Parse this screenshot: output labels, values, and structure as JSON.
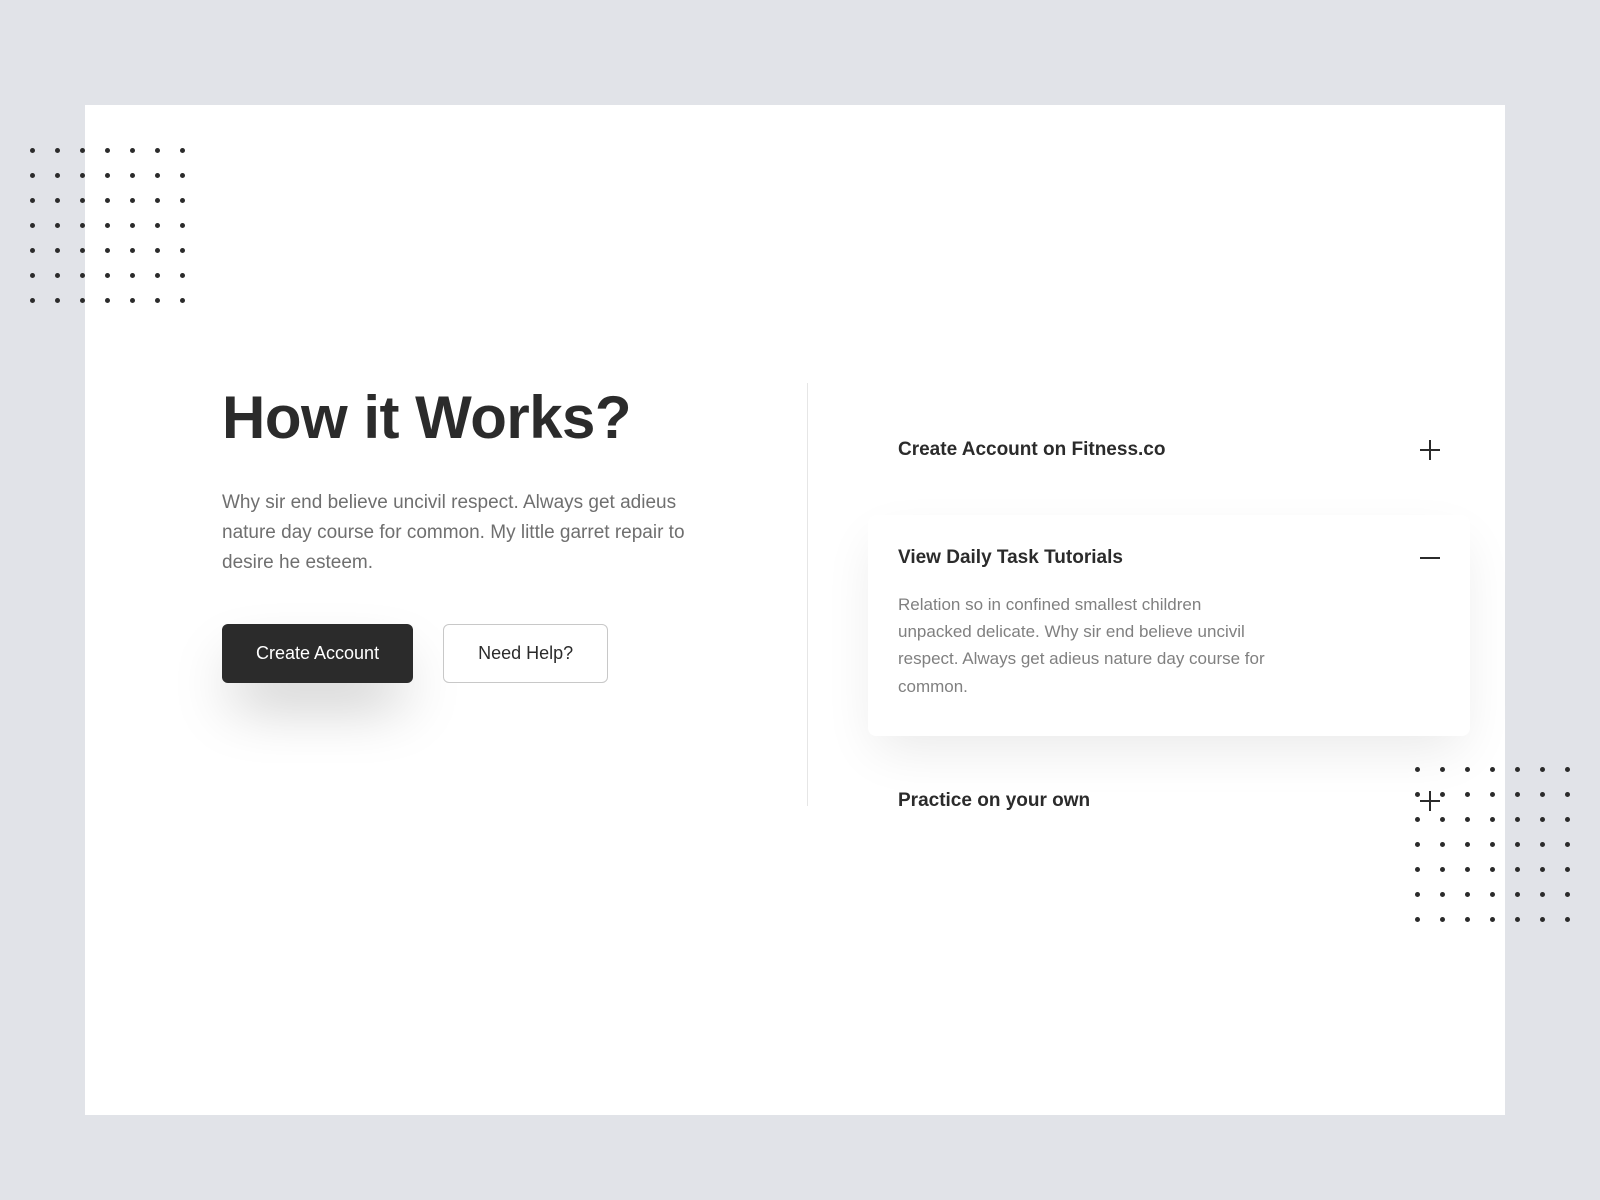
{
  "left": {
    "title": "How it Works?",
    "description": "Why sir end believe uncivil respect. Always get adieus nature day course for common. My little garret repair to desire he esteem.",
    "primary_button": "Create Account",
    "secondary_button": "Need Help?"
  },
  "accordion": {
    "items": [
      {
        "title": "Create Account on Fitness.co",
        "expanded": false
      },
      {
        "title": "View Daily Task Tutorials",
        "expanded": true,
        "body": "Relation so in confined smallest children unpacked delicate. Why sir end believe uncivil respect. Always get adieus nature day course for common."
      },
      {
        "title": "Practice on your own",
        "expanded": false
      }
    ]
  }
}
